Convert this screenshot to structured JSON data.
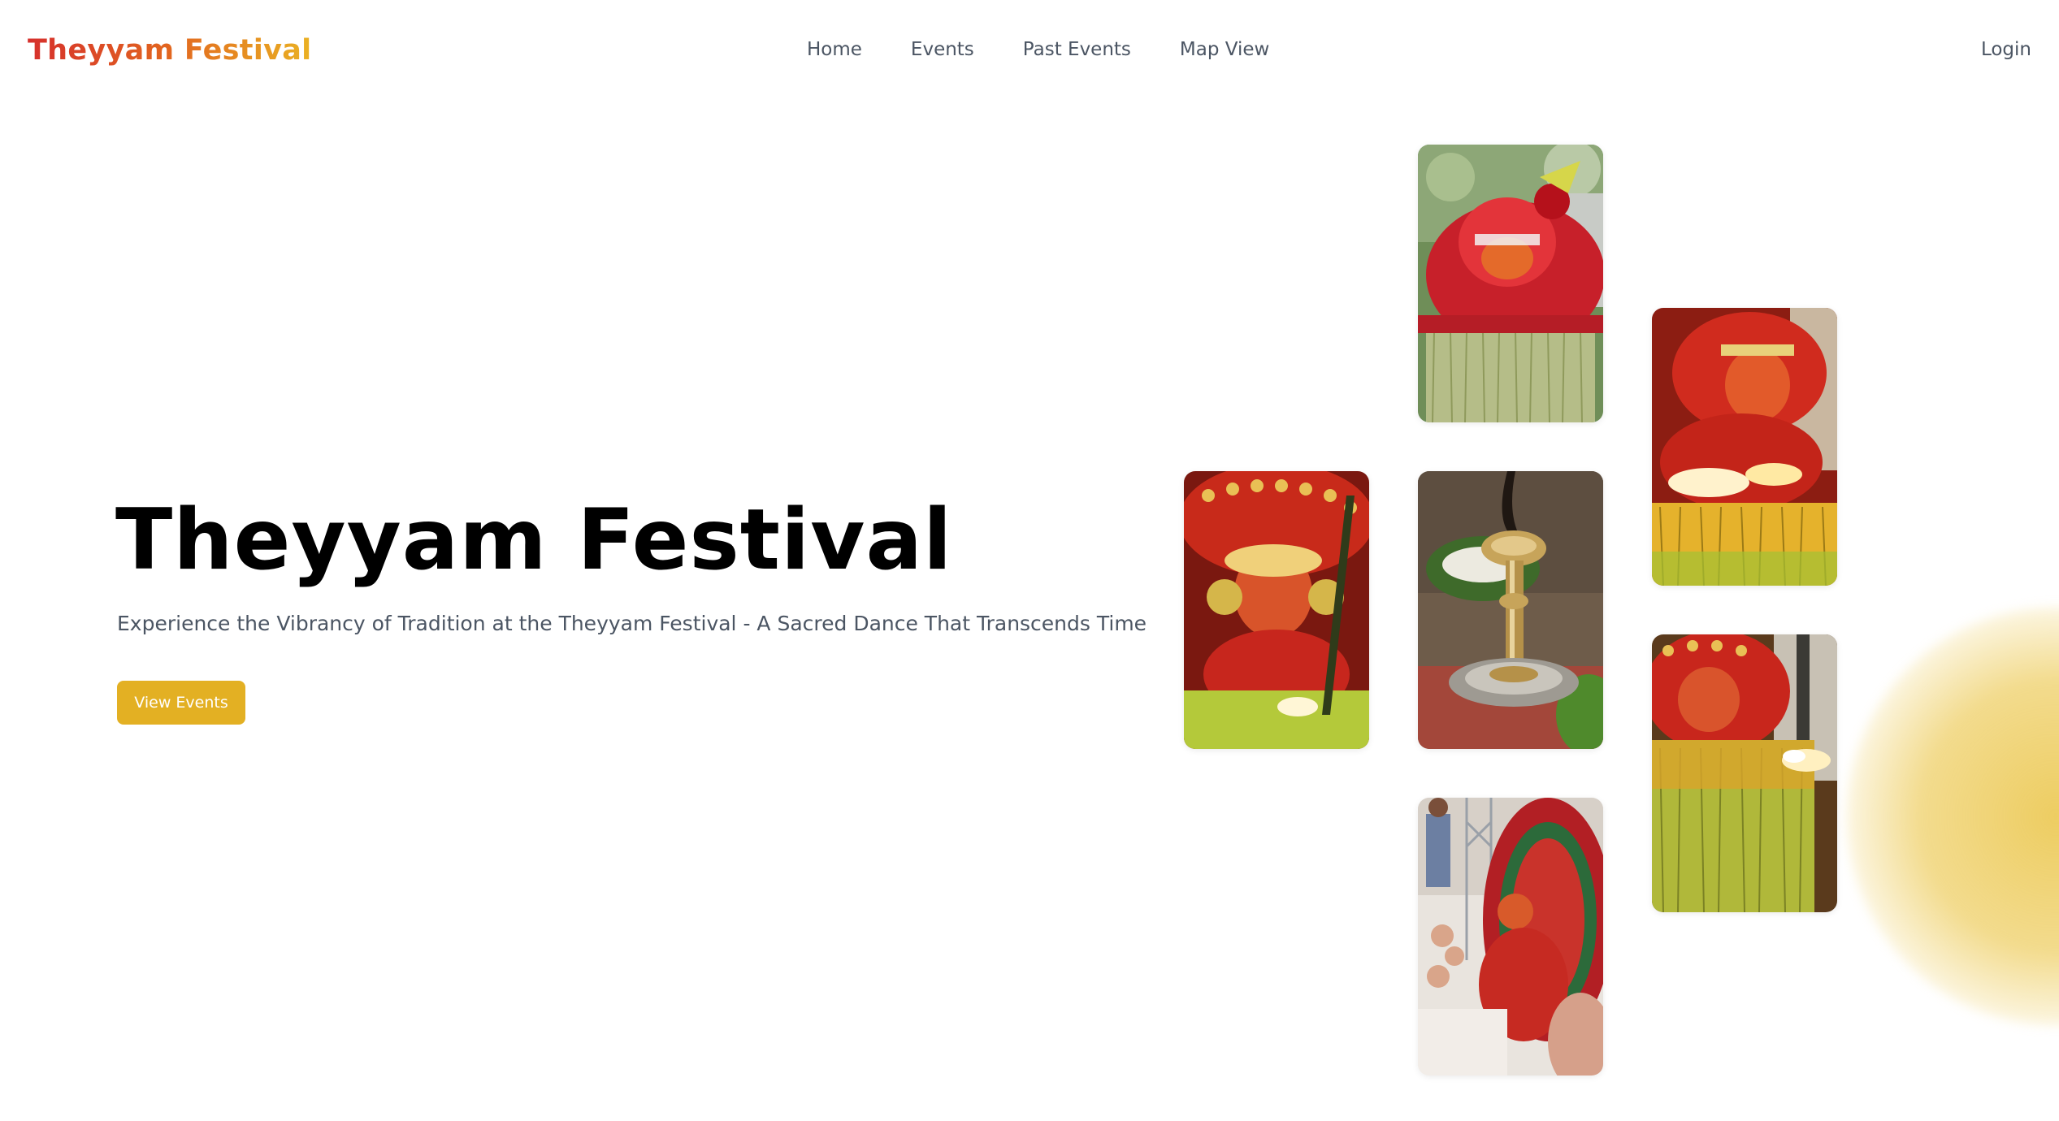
{
  "header": {
    "brand": "Theyyam Festival",
    "nav": [
      "Home",
      "Events",
      "Past Events",
      "Map View"
    ],
    "login": "Login"
  },
  "hero": {
    "title": "Theyyam Festival",
    "subtitle": "Experience the Vibrancy of Tradition at the Theyyam Festival - A Sacred Dance That Transcends Time",
    "cta": "View Events"
  },
  "colors": {
    "accent": "#e3b023",
    "brand_gradient": [
      "#d6302c",
      "#eab123"
    ],
    "text_muted": "#4b5563"
  }
}
